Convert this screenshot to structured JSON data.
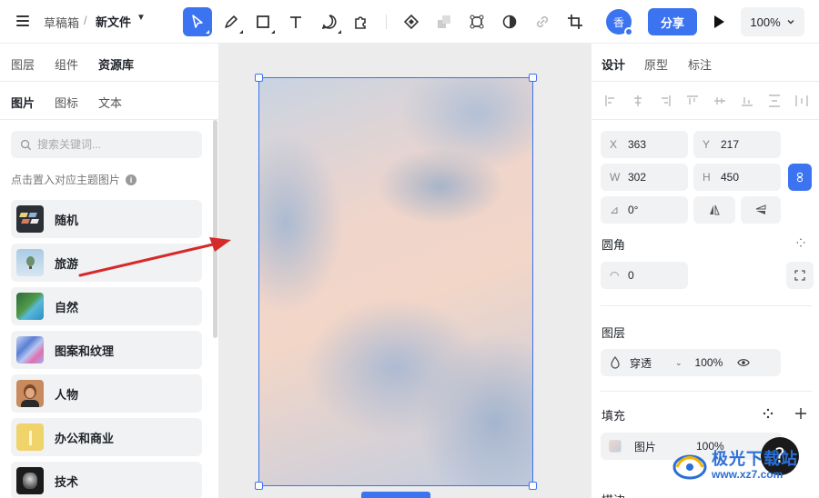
{
  "header": {
    "breadcrumb_root": "草稿箱",
    "breadcrumb_sep": "/",
    "file_name": "新文件",
    "avatar_initial": "香",
    "share_label": "分享",
    "zoom_value": "100%"
  },
  "toolbar": {
    "tools": [
      "select-tool",
      "pen-tool",
      "rectangle-tool",
      "text-tool",
      "comment-tool",
      "plugin-tool",
      "component-tool",
      "component-set-tool",
      "frame-transform-tool",
      "mask-tool",
      "link-tool",
      "crop-tool"
    ]
  },
  "left_panel": {
    "top_tabs": [
      "图层",
      "组件",
      "资源库"
    ],
    "sub_tabs": [
      "图片",
      "图标",
      "文本"
    ],
    "search_placeholder": "搜索关键词...",
    "hint": "点击置入对应主题图片",
    "categories": [
      {
        "label": "随机"
      },
      {
        "label": "旅游"
      },
      {
        "label": "自然"
      },
      {
        "label": "图案和纹理"
      },
      {
        "label": "人物"
      },
      {
        "label": "办公和商业"
      },
      {
        "label": "技术"
      }
    ]
  },
  "right_panel": {
    "tabs": [
      "设计",
      "原型",
      "标注"
    ],
    "x_label": "X",
    "x_value": "363",
    "y_label": "Y",
    "y_value": "217",
    "w_label": "W",
    "w_value": "302",
    "h_label": "H",
    "h_value": "450",
    "rotation_value": "0°",
    "corner_title": "圆角",
    "corner_value": "0",
    "layer_title": "图层",
    "blend_mode": "穿透",
    "layer_opacity": "100%",
    "fill_title": "填充",
    "fill_type": "图片",
    "fill_opacity": "100%",
    "stroke_title": "描边"
  },
  "watermark": {
    "name": "极光下载站",
    "url": "www.xz7.com"
  },
  "help_label": "?"
}
